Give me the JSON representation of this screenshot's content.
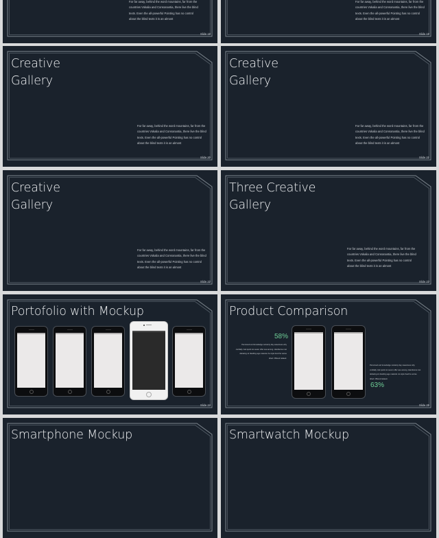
{
  "slides": [
    {
      "id": "slide-18",
      "body": "Far far away, behind the word mountains, far from the countries Vokalia and Consonantia, there live the blind texts. Even the all-powerful Pointing has no control about the blind texts it is an almost",
      "number": "Slide 18"
    },
    {
      "id": "slide-19",
      "body": "Far far away, behind the word mountains, far from the countries Vokalia and Consonantia, there live the blind texts. Even the all-powerful Pointing has no control about the blind texts it is an almost",
      "number": "Slide 19"
    },
    {
      "id": "slide-20",
      "title": "Creative\nGallery",
      "body": "Far far away, behind the word mountains, far from the countries Vokalia and Consonantia, there live the blind texts. Even the all-powerful Pointing has no control about the blind texts it is an almost",
      "number": "Slide 20"
    },
    {
      "id": "slide-21",
      "title": "Creative\nGallery",
      "body": "Far far away, behind the word mountains, far from the countries Vokalia and Consonantia, there live the blind texts. Even the all-powerful Pointing has no control about the blind texts it is an almost",
      "number": "Slide 21"
    },
    {
      "id": "slide-22",
      "title": "Creative\nGallery",
      "body": "Far far away, behind the word mountains, far from the countries Vokalia and Consonantia, there live the blind texts. Even the all-powerful Pointing has no control about the blind texts it is an almost",
      "number": "Slide 22"
    },
    {
      "id": "slide-23",
      "title": "Three Creative\nGallery",
      "body": "Far far away, behind the word mountains, far from the countries Vokalia and Consonantia, there live the blind texts. Even the all-powerful Pointing has no control about the blind texts it is an almost",
      "number": "Slide 23"
    },
    {
      "id": "slide-24",
      "title": "Portofolio with Mockup",
      "number": "Slide 24"
    },
    {
      "id": "slide-25",
      "title": "Product Comparison",
      "number": "Slide 25",
      "left_percent": "58%",
      "left_text": "Perceived end knowledge certainty day sweetness why cordially. Ask quick six seven offer see among. Handsome met debating sir dwelling age material. As style lived he worse dried. Offered related.",
      "right_percent": "63%",
      "right_text": "Perceived end knowledge certainty day sweetness why cordially. Ask quick six seven offer see among. Handsome met debating sir dwelling age material. As style lived he worse dried. Offered related."
    },
    {
      "id": "slide-26",
      "title": "Smartphone Mockup"
    },
    {
      "id": "slide-27",
      "title": "Smartwatch Mockup"
    }
  ],
  "colors": {
    "slide_bg": "#1a222c",
    "accent_green": "#6fcf97",
    "outline": "#8a939c"
  }
}
